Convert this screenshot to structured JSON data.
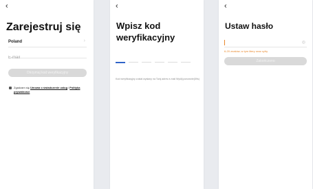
{
  "screen1": {
    "back_glyph": "‹",
    "title": "Zarejestruj się",
    "country": "Poland",
    "email_placeholder": "E-mail",
    "get_code_button": "Otrzymaj kod weryfikacyjny",
    "terms_prefix": "Zgadzam się ",
    "terms_link1": "Umowa o świadczenie usług",
    "terms_mid": " i ",
    "terms_link2": "Polityka prywatności"
  },
  "screen2": {
    "back_glyph": "‹",
    "title": "Wpisz kod weryfikacyjny",
    "hint": "Kod weryfikacyjny został wysłany na Twój adres e-mail Wyślij ponownie(59s)"
  },
  "screen3": {
    "back_glyph": "‹",
    "title": "Ustaw hasło",
    "password_rule": "6-20 znaków, w tym litery oraz cyfry",
    "done_button": "Zakończono"
  },
  "colors": {
    "accent_blue": "#2f63c8",
    "accent_orange": "#e8862a",
    "button_disabled": "#d9d9d9"
  },
  "icons": {
    "back": "chevron-left-icon",
    "dropdown": "chevron-right-icon",
    "eye": "eye-icon"
  }
}
